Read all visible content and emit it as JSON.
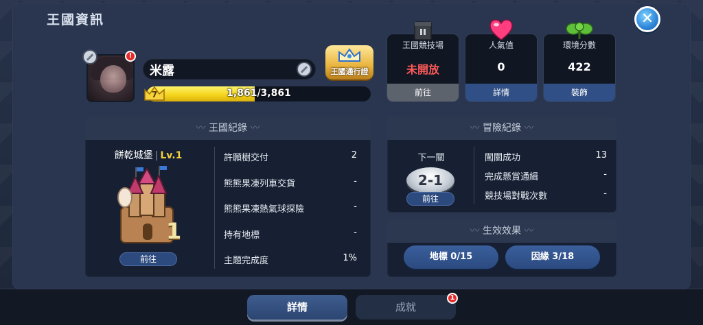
{
  "header": {
    "title": "王國資訊"
  },
  "profile": {
    "name": "米露",
    "level": "7",
    "xp_text": "1,861/3,861",
    "xp_fraction": 0.482,
    "alert_badge": "!",
    "pass_label": "王國通行證"
  },
  "stats": [
    {
      "title": "王國競技場",
      "value": "未開放",
      "footer": "前往",
      "icon": "arena-tower-icon"
    },
    {
      "title": "人氣值",
      "value": "0",
      "footer": "詳情",
      "icon": "heart-icon"
    },
    {
      "title": "環境分數",
      "value": "422",
      "footer": "裝飾",
      "icon": "clover-icon"
    }
  ],
  "kingdom_record": {
    "header": "王國紀錄",
    "castle_name": "餅乾城堡",
    "castle_sep": "|",
    "castle_level": "Lv.1",
    "castle_level_number": "1",
    "go_button": "前往",
    "rows": [
      {
        "label": "許願樹交付",
        "value": "2"
      },
      {
        "label": "熊熊果凍列車交貨",
        "value": "-"
      },
      {
        "label": "熊熊果凍熱氣球探險",
        "value": "-"
      },
      {
        "label": "持有地標",
        "value": "-"
      },
      {
        "label": "主題完成度",
        "value": "1%"
      }
    ]
  },
  "adventure_record": {
    "header": "冒險紀錄",
    "next_stage_label": "下一關",
    "next_stage": "2-1",
    "go_button": "前往",
    "rows": [
      {
        "label": "闖關成功",
        "value": "13"
      },
      {
        "label": "完成懸賞通緝",
        "value": "-"
      },
      {
        "label": "競技場對戰次數",
        "value": "-"
      }
    ]
  },
  "effects": {
    "header": "生效效果",
    "buttons": [
      {
        "label": "地標 0/15"
      },
      {
        "label": "因緣 3/18"
      }
    ]
  },
  "tabs": {
    "details": "詳情",
    "achievements": "成就",
    "achievements_badge": "1"
  },
  "colors": {
    "accent_blue": "#2f4f86",
    "xp_yellow": "#f3d21a",
    "alert_red": "#e52a2a",
    "closed_red": "#ff5a5a",
    "level_gold": "#f2cf3c"
  }
}
